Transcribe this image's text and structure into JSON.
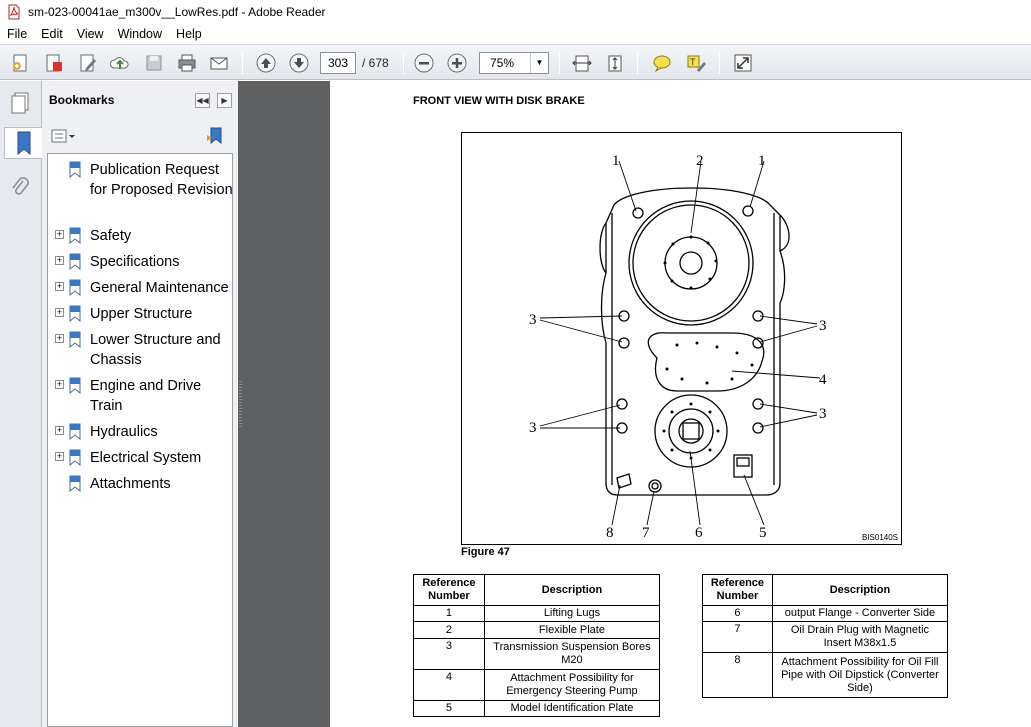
{
  "window": {
    "title": "sm-023-00041ae_m300v__LowRes.pdf - Adobe Reader"
  },
  "menu": {
    "items": [
      "File",
      "Edit",
      "View",
      "Window",
      "Help"
    ]
  },
  "toolbar": {
    "current_page": "303",
    "total_pages": "/ 678",
    "zoom": "75%"
  },
  "bookmarks": {
    "header": "Bookmarks",
    "items": [
      {
        "label": "Publication Request for Proposed Revision",
        "expandable": false,
        "expander": ""
      },
      {
        "label": "Safety",
        "expandable": true,
        "expander": "+"
      },
      {
        "label": "Specifications",
        "expandable": true,
        "expander": "+"
      },
      {
        "label": "General Maintenance",
        "expandable": true,
        "expander": "+"
      },
      {
        "label": "Upper Structure",
        "expandable": true,
        "expander": "+"
      },
      {
        "label": "Lower Structure and Chassis",
        "expandable": true,
        "expander": "+"
      },
      {
        "label": "Engine and Drive Train",
        "expandable": true,
        "expander": "+"
      },
      {
        "label": "Hydraulics",
        "expandable": true,
        "expander": "+"
      },
      {
        "label": "Electrical System",
        "expandable": true,
        "expander": "+"
      },
      {
        "label": "Attachments",
        "expandable": false,
        "expander": ""
      }
    ]
  },
  "document": {
    "heading": "FRONT VIEW WITH DISK BRAKE",
    "figure_code": "BIS0140S",
    "figure_caption": "Figure 47",
    "callouts": {
      "n1": "1",
      "n2": "2",
      "n3": "3",
      "n4": "4",
      "n5": "5",
      "n6": "6",
      "n7": "7",
      "n8": "8"
    },
    "table_headers": {
      "ref": "Reference Number",
      "desc": "Description"
    },
    "table_left": [
      {
        "ref": "1",
        "desc": "Lifting Lugs"
      },
      {
        "ref": "2",
        "desc": "Flexible Plate"
      },
      {
        "ref": "3",
        "desc": "Transmission Suspension Bores M20"
      },
      {
        "ref": "4",
        "desc": "Attachment Possibility for Emergency Steering Pump"
      },
      {
        "ref": "5",
        "desc": "Model Identification Plate"
      }
    ],
    "table_right": [
      {
        "ref": "6",
        "desc": "output Flange - Converter Side"
      },
      {
        "ref": "7",
        "desc": "Oil Drain Plug with Magnetic Insert M38x1.5"
      },
      {
        "ref": "8",
        "desc": "Attachment Possibility for Oil Fill Pipe with Oil Dipstick (Converter Side)"
      }
    ]
  }
}
